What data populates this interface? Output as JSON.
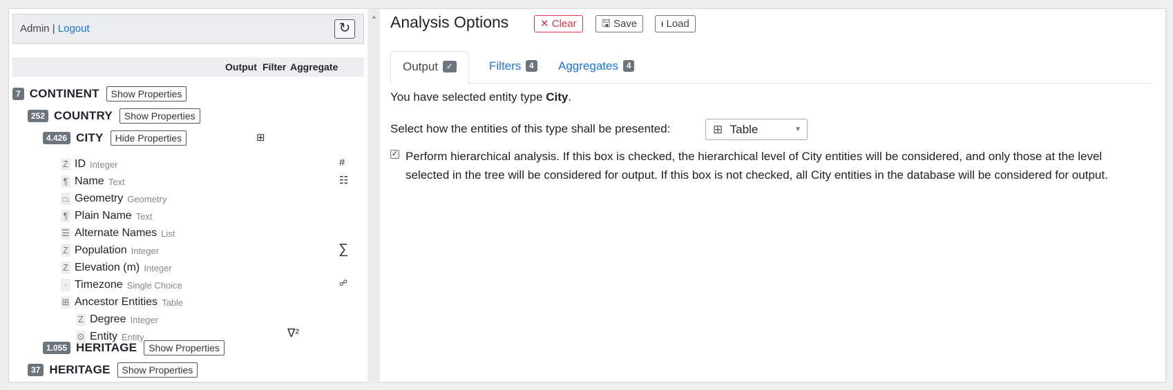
{
  "user": {
    "name": "Admin",
    "separator": "|",
    "logout_label": "Logout",
    "refresh_icon": "refresh-icon"
  },
  "columns": {
    "output": "Output",
    "filter": "Filter",
    "aggregate": "Aggregate"
  },
  "tree": {
    "continent": {
      "count": "7",
      "name": "CONTINENT",
      "button": "Show Properties"
    },
    "country": {
      "count": "252",
      "name": "COUNTRY",
      "button": "Show Properties"
    },
    "city": {
      "count": "4.426",
      "name": "CITY",
      "button": "Hide Properties",
      "output_icon": "⊞"
    },
    "properties": [
      {
        "icon": "Z",
        "name": "ID",
        "type": "Integer",
        "agg": "#"
      },
      {
        "icon": "¶",
        "name": "Name",
        "type": "Text",
        "agg": "☷"
      },
      {
        "icon": "⏢",
        "name": "Geometry",
        "type": "Geometry",
        "agg": ""
      },
      {
        "icon": "¶",
        "name": "Plain Name",
        "type": "Text",
        "agg": ""
      },
      {
        "icon": "☰",
        "name": "Alternate Names",
        "type": "List",
        "agg": ""
      },
      {
        "icon": "Z",
        "name": "Population",
        "type": "Integer",
        "agg": "∑"
      },
      {
        "icon": "Z",
        "name": "Elevation (m)",
        "type": "Integer",
        "agg": ""
      },
      {
        "icon": "·",
        "name": "Timezone",
        "type": "Single Choice",
        "agg": "☍"
      },
      {
        "icon": "⊞",
        "name": "Ancestor Entities",
        "type": "Table",
        "agg": ""
      }
    ],
    "sub_properties": [
      {
        "icon": "Z",
        "name": "Degree",
        "type": "Integer"
      },
      {
        "icon": "⊙",
        "name": "Entity",
        "type": "Entity",
        "filter": "∇²"
      }
    ],
    "heritage_child": {
      "count": "1.055",
      "name": "HERITAGE",
      "button": "Show Properties"
    },
    "heritage": {
      "count": "37",
      "name": "HERITAGE",
      "button": "Show Properties"
    }
  },
  "analysis": {
    "title": "Analysis Options",
    "clear_label": "✕ Clear",
    "save_label": "🖫 Save",
    "load_label": "ᵼ Load",
    "tabs": [
      {
        "label": "Output",
        "badge": "✓"
      },
      {
        "label": "Filters",
        "badge": "4"
      },
      {
        "label": "Aggregates",
        "badge": "4"
      }
    ],
    "selected_prefix": "You have selected entity type ",
    "selected_entity": "City",
    "selected_suffix": ".",
    "present_label": "Select how the entities of this type shall be presented:",
    "present_value": "Table",
    "hierarchical_checked": true,
    "hierarchical_text": "Perform hierarchical analysis. If this box is checked, the hierarchical level of City entities will be considered, and only those at the level selected in the tree will be considered for output. If this box is not checked, all City entities in the database will be considered for output."
  },
  "colors": {
    "accent": "#1a73e8",
    "danger": "#dc3545",
    "badge": "#6c757d"
  }
}
